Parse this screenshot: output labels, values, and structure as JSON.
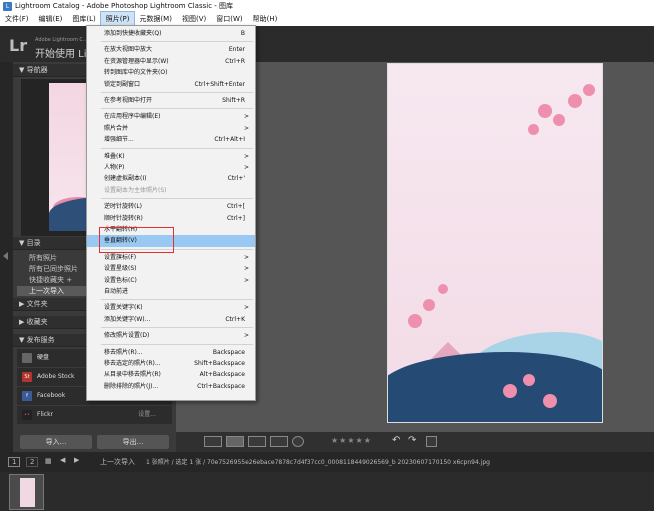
{
  "window": {
    "title": "Lightroom Catalog - Adobe Photoshop Lightroom Classic - 图库"
  },
  "menubar": [
    "文件(F)",
    "编辑(E)",
    "图库(L)",
    "照片(P)",
    "元数据(M)",
    "视图(V)",
    "窗口(W)",
    "帮助(H)"
  ],
  "identity": {
    "logo": "Lr",
    "sub": "Adobe Lightroom C...",
    "start": "开始使用 Li"
  },
  "left_panel": {
    "navigator": "导航器",
    "catalog": "目录",
    "catalog_items": [
      "所有照片",
      "所有已同步照片",
      "快捷收藏夹 +",
      "上一次导入"
    ],
    "folders": "文件夹",
    "collections": "收藏夹",
    "publish": "发布服务",
    "publish_items": [
      "硬盘",
      "Adobe Stock",
      "Facebook",
      "Flickr"
    ],
    "flickr_note": "设置...",
    "import_btn": "导入...",
    "export_btn": "导出..."
  },
  "menu": {
    "items": [
      {
        "label": "添加到快捷收藏夹(Q)",
        "shortcut": "B"
      },
      {
        "sep": true
      },
      {
        "label": "在放大视图中放大",
        "shortcut": "Enter"
      },
      {
        "label": "在资源管理器中显示(W)",
        "shortcut": "Ctrl+R"
      },
      {
        "label": "转到图库中的文件夹(O)",
        "shortcut": ""
      },
      {
        "label": "锁定到副窗口",
        "shortcut": "Ctrl+Shift+Enter"
      },
      {
        "sep": true
      },
      {
        "label": "在参考视图中打开",
        "shortcut": "Shift+R"
      },
      {
        "sep": true
      },
      {
        "label": "在应用程序中编辑(E)",
        "arrow": ">"
      },
      {
        "label": "照片合并",
        "arrow": ">"
      },
      {
        "label": "增强细节...",
        "shortcut": "Ctrl+Alt+I"
      },
      {
        "sep": true
      },
      {
        "label": "堆叠(K)",
        "arrow": ">"
      },
      {
        "label": "人物(P)",
        "arrow": ">"
      },
      {
        "label": "创建虚拟副本(I)",
        "shortcut": "Ctrl+'"
      },
      {
        "label": "设置副本为主体照片(S)",
        "disabled": true
      },
      {
        "sep": true
      },
      {
        "label": "逆时针旋转(L)",
        "shortcut": "Ctrl+["
      },
      {
        "label": "顺时针旋转(R)",
        "shortcut": "Ctrl+]"
      },
      {
        "label": "水平翻转(H)"
      },
      {
        "label": "垂直翻转(V)",
        "highlighted": true
      },
      {
        "sep": true
      },
      {
        "label": "设置旗标(F)",
        "arrow": ">"
      },
      {
        "label": "设置星级(S)",
        "arrow": ">"
      },
      {
        "label": "设置色标(C)",
        "arrow": ">"
      },
      {
        "label": "自动前进"
      },
      {
        "sep": true
      },
      {
        "label": "设置关键字(K)",
        "arrow": ">"
      },
      {
        "label": "添加关键字(W)...",
        "shortcut": "Ctrl+K"
      },
      {
        "sep": true
      },
      {
        "label": "修改照片设置(D)",
        "arrow": ">"
      },
      {
        "sep": true
      },
      {
        "label": "移去照片(R)...",
        "shortcut": "Backspace"
      },
      {
        "label": "移去选定的照片(R)...",
        "shortcut": "Shift+Backspace"
      },
      {
        "label": "从目录中移去照片(R)",
        "shortcut": "Alt+Backspace"
      },
      {
        "label": "删除排除的照片(J)...",
        "shortcut": "Ctrl+Backspace"
      }
    ]
  },
  "filmstrip": {
    "page1": "1",
    "page2": "2",
    "source": "上一次导入",
    "count": "1 张照片 / 选定 1 张 / 70e7526955e26ebace7878c7d4f37cc0_0008118449026569_b 20230607170150 x6cpn94.jpg"
  }
}
